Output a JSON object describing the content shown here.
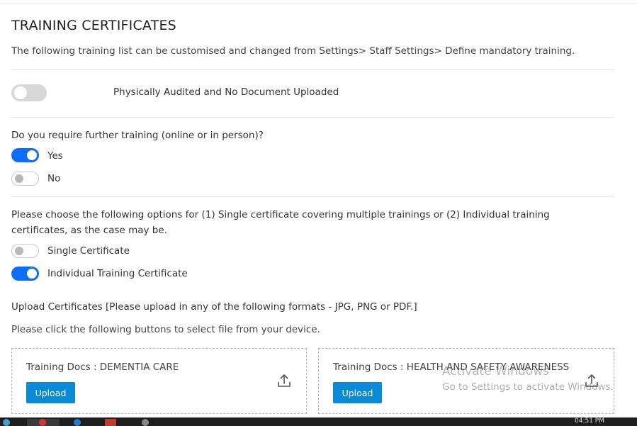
{
  "section": {
    "title": "TRAINING CERTIFICATES",
    "description": "The following training list can be customised and changed from Settings> Staff Settings> Define mandatory training."
  },
  "audit": {
    "label": "Physically Audited and No Document Uploaded",
    "enabled": false
  },
  "further_training": {
    "question": "Do you require further training (online or in person)?",
    "options": [
      {
        "label": "Yes",
        "selected": true
      },
      {
        "label": "No",
        "selected": false
      }
    ]
  },
  "certificate_type": {
    "question": "Please choose the following options for (1) Single certificate covering multiple trainings or (2) Individual training certificates, as the case may be.",
    "options": [
      {
        "label": "Single Certificate",
        "selected": false
      },
      {
        "label": "Individual Training Certificate",
        "selected": true
      }
    ]
  },
  "upload": {
    "heading": "Upload Certificates [Please upload in any of the following formats - JPG, PNG or PDF.]",
    "instruction": "Please click the following buttons to select file from your device.",
    "cards": [
      {
        "title": "Training Docs : DEMENTIA CARE",
        "button": "Upload",
        "icon": "upload-icon"
      },
      {
        "title": "Training Docs : HEALTH AND SAFETY AWARENESS",
        "button": "Upload",
        "icon": "upload-icon"
      }
    ]
  },
  "watermark": {
    "line1": "Activate Windows",
    "line2": "Go to Settings to activate Windows."
  },
  "taskbar": {
    "clock": "04:51 PM"
  },
  "colors": {
    "accent": "#0d6efd",
    "button": "#0a8ad6",
    "toggle_off": "#d7d7d7"
  }
}
